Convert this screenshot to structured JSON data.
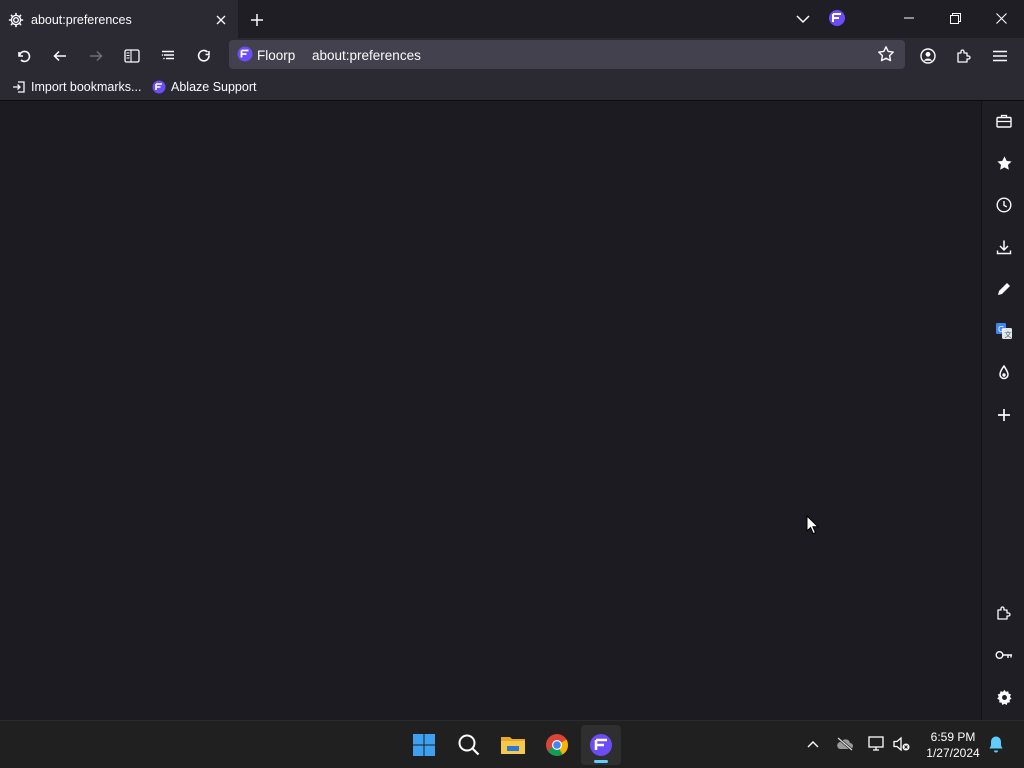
{
  "tab": {
    "title": "about:preferences"
  },
  "urlbar": {
    "brand": "Floorp",
    "url": "about:preferences"
  },
  "bookmarks": [
    {
      "label": "Import bookmarks..."
    },
    {
      "label": "Ablaze Support"
    }
  ],
  "clock": {
    "time": "6:59 PM",
    "date": "1/27/2024"
  },
  "colors": {
    "floorp_purple": "#6b4cf6",
    "accent_blue": "#60cdff",
    "toolbar": "#2b2a33",
    "urlbar": "#42414d"
  }
}
